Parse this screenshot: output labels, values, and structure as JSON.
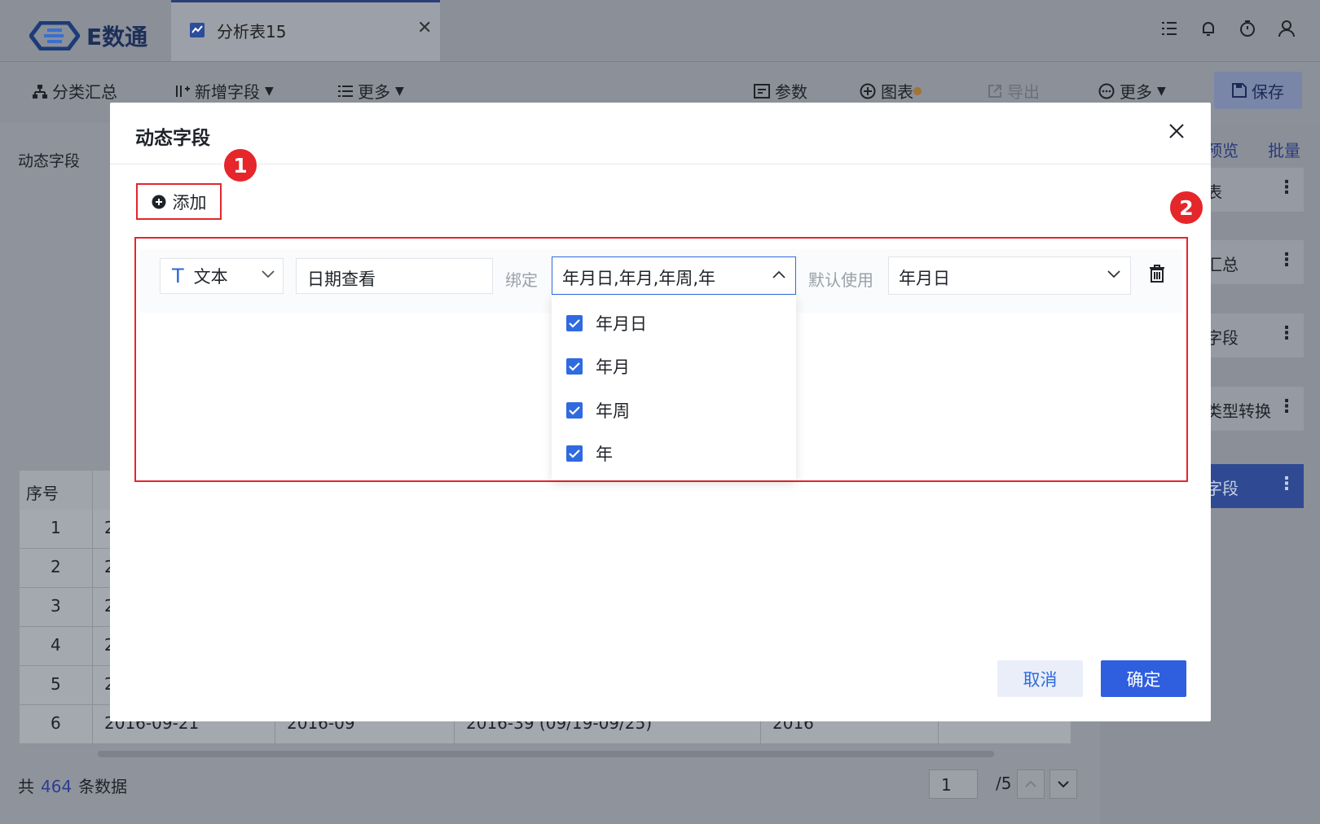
{
  "app": {
    "logo_text": "E数通",
    "tab_label": "分析表15"
  },
  "toolbar": {
    "group_summary": "分类汇总",
    "add_field": "新增字段",
    "more_left": "更多",
    "params": "参数",
    "chart": "图表",
    "export": "导出",
    "more_right": "更多",
    "save": "保存"
  },
  "left": {
    "dynamic_field_label": "动态字段"
  },
  "right_panel": {
    "preview_link": "预览",
    "batch_link": "批量",
    "items": [
      {
        "label": "表"
      },
      {
        "label": "汇总"
      },
      {
        "label": "字段"
      },
      {
        "label": "类型转换"
      },
      {
        "label": "字段",
        "active": true
      }
    ]
  },
  "table": {
    "headers": [
      "序号"
    ],
    "rows": [
      {
        "index": "1",
        "cells": [
          "2"
        ]
      },
      {
        "index": "2",
        "cells": [
          "2"
        ]
      },
      {
        "index": "3",
        "cells": [
          "2"
        ]
      },
      {
        "index": "4",
        "cells": [
          "2"
        ]
      },
      {
        "index": "5",
        "cells": [
          "2"
        ]
      },
      {
        "index": "6",
        "cells": [
          "2016-09-21",
          "2016-09",
          "2016-39 (09/19-09/25)",
          "2016"
        ]
      }
    ]
  },
  "footer": {
    "total_prefix": "共",
    "total_count": "464",
    "total_suffix": "条数据",
    "page_current": "1",
    "page_total": "/5"
  },
  "modal": {
    "title": "动态字段",
    "add_button": "添加",
    "badge_1": "1",
    "badge_2": "2",
    "field": {
      "type_icon": "T",
      "type_label": "文本",
      "name_value": "日期查看",
      "bind_label": "绑定",
      "bind_value": "年月日,年月,年周,年",
      "default_label": "默认使用",
      "default_value": "年月日"
    },
    "bind_options": [
      {
        "label": "年月日",
        "checked": true
      },
      {
        "label": "年月",
        "checked": true
      },
      {
        "label": "年周",
        "checked": true
      },
      {
        "label": "年",
        "checked": true
      }
    ],
    "cancel_button": "取消",
    "confirm_button": "确定"
  },
  "colors": {
    "accent": "#2f5fde",
    "highlight_red": "#e5262b",
    "overlay": "#8e939c"
  }
}
